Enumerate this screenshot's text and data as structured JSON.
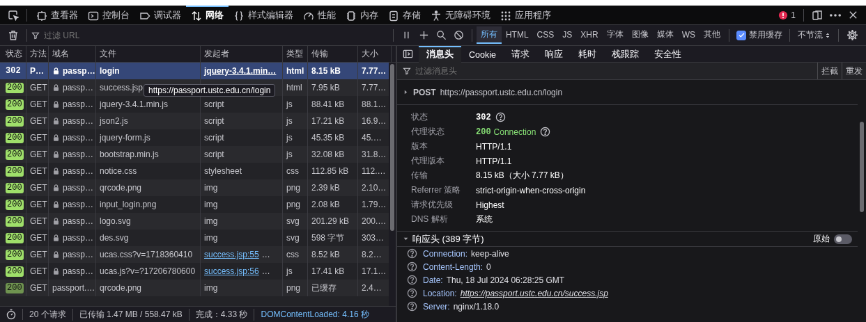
{
  "toolbar": {
    "tabs": [
      {
        "label": "查看器",
        "kind": "inspector",
        "selected": false
      },
      {
        "label": "控制台",
        "kind": "console",
        "selected": false
      },
      {
        "label": "调试器",
        "kind": "debugger",
        "selected": false
      },
      {
        "label": "网络",
        "kind": "network",
        "selected": true
      },
      {
        "label": "样式编辑器",
        "kind": "style",
        "selected": false
      },
      {
        "label": "性能",
        "kind": "performance",
        "selected": false
      },
      {
        "label": "内存",
        "kind": "memory",
        "selected": false
      },
      {
        "label": "存储",
        "kind": "storage",
        "selected": false
      },
      {
        "label": "无障碍环境",
        "kind": "accessibility",
        "selected": false
      },
      {
        "label": "应用程序",
        "kind": "application",
        "selected": false
      }
    ],
    "error_count": "1"
  },
  "network_toolbar": {
    "filter_placeholder": "过滤 URL",
    "type_filters": [
      {
        "label": "所有",
        "selected": true
      },
      {
        "label": "HTML",
        "selected": false
      },
      {
        "label": "CSS",
        "selected": false
      },
      {
        "label": "JS",
        "selected": false
      },
      {
        "label": "XHR",
        "selected": false
      },
      {
        "label": "字体",
        "selected": false
      },
      {
        "label": "图像",
        "selected": false
      },
      {
        "label": "媒体",
        "selected": false
      },
      {
        "label": "WS",
        "selected": false
      },
      {
        "label": "其他",
        "selected": false
      }
    ],
    "disable_cache": {
      "label": "禁用缓存",
      "checked": true
    },
    "throttle": "不节流"
  },
  "table": {
    "columns": [
      "状态",
      "方法",
      "域名",
      "文件",
      "发起者",
      "类型",
      "传输",
      "大小"
    ],
    "rows": [
      {
        "status": "302",
        "method": "P…",
        "secure": true,
        "domain": "passp…",
        "file": "login",
        "initiator": "jquery-3.4.1.min…",
        "initiator_link": true,
        "type": "html",
        "transfer": "8.15 kB",
        "size": "7.77…",
        "selected": true
      },
      {
        "status": "200",
        "method": "GET",
        "secure": true,
        "domain": "passp…",
        "file": "success.jsp",
        "type": "html",
        "transfer": "7.95 kB",
        "size": "7.77…",
        "selected": false
      },
      {
        "status": "200",
        "method": "GET",
        "secure": true,
        "domain": "passp…",
        "file": "jquery-3.4.1.min.js",
        "initiator": "script",
        "type": "js",
        "transfer": "88.41 kB",
        "size": "88.1…",
        "selected": false
      },
      {
        "status": "200",
        "method": "GET",
        "secure": true,
        "domain": "passp…",
        "file": "json2.js",
        "initiator": "script",
        "type": "js",
        "transfer": "17.21 kB",
        "size": "16.9…",
        "selected": false
      },
      {
        "status": "200",
        "method": "GET",
        "secure": true,
        "domain": "passp…",
        "file": "jquery-form.js",
        "initiator": "script",
        "type": "js",
        "transfer": "45.35 kB",
        "size": "45.…",
        "selected": false
      },
      {
        "status": "200",
        "method": "GET",
        "secure": true,
        "domain": "passp…",
        "file": "bootstrap.min.js",
        "initiator": "script",
        "type": "js",
        "transfer": "32.08 kB",
        "size": "31.8…",
        "selected": false
      },
      {
        "status": "200",
        "method": "GET",
        "secure": true,
        "domain": "passp…",
        "file": "notice.css",
        "initiator": "stylesheet",
        "type": "css",
        "transfer": "112.85 kB",
        "size": "112.…",
        "selected": false
      },
      {
        "status": "200",
        "method": "GET",
        "secure": true,
        "domain": "passp…",
        "file": "qrcode.png",
        "initiator": "img",
        "type": "png",
        "transfer": "2.39 kB",
        "size": "2.10…",
        "selected": false
      },
      {
        "status": "200",
        "method": "GET",
        "secure": true,
        "domain": "passp…",
        "file": "input_login.png",
        "initiator": "img",
        "type": "png",
        "transfer": "2.08 kB",
        "size": "1.79…",
        "selected": false
      },
      {
        "status": "200",
        "method": "GET",
        "secure": true,
        "domain": "passp…",
        "file": "logo.svg",
        "initiator": "img",
        "type": "svg",
        "transfer": "201.29 kB",
        "size": "200.…",
        "selected": false
      },
      {
        "status": "200",
        "method": "GET",
        "secure": true,
        "domain": "passp…",
        "file": "des.svg",
        "initiator": "img",
        "type": "svg",
        "transfer": "598 字节",
        "size": "303…",
        "selected": false
      },
      {
        "status": "200",
        "method": "GET",
        "secure": true,
        "domain": "passp…",
        "file": "ucas.css?v=1718360410",
        "initiator": "success.jsp:55",
        "initiator_link": true,
        "initiator_more": "…",
        "type": "css",
        "transfer": "8.52 kB",
        "size": "8.2…",
        "selected": false
      },
      {
        "status": "200",
        "method": "GET",
        "secure": true,
        "domain": "passp…",
        "file": "ucas.js?v=?17206780600",
        "initiator": "success.jsp:56",
        "initiator_link": true,
        "initiator_more": "…",
        "type": "js",
        "transfer": "17.41 kB",
        "size": "17.1…",
        "selected": false
      },
      {
        "status": "200",
        "method": "GET",
        "secure": false,
        "domain": "passport.…",
        "file": "qrcode.png",
        "initiator": "img",
        "type": "png",
        "transfer": "已缓存",
        "size": "2.4…",
        "cached": true,
        "selected": false
      }
    ],
    "tooltip": "https://passport.ustc.edu.cn/login"
  },
  "summary": [
    {
      "text": "20 个请求",
      "kind": "plain"
    },
    {
      "text": "已传输 1.47 MB / 558.47 kB",
      "kind": "plain"
    },
    {
      "text": "完成：4.33 秒",
      "kind": "plain"
    },
    {
      "text": "DOMContentLoaded: 4.16 秒",
      "kind": "event"
    }
  ],
  "details": {
    "tabs": [
      {
        "label": "消息头",
        "selected": true
      },
      {
        "label": "Cookie",
        "selected": false
      },
      {
        "label": "请求",
        "selected": false
      },
      {
        "label": "响应",
        "selected": false
      },
      {
        "label": "耗时",
        "selected": false
      },
      {
        "label": "栈跟踪",
        "selected": false
      },
      {
        "label": "安全性",
        "selected": false
      }
    ],
    "filter_placeholder": "过滤消息头",
    "actions": [
      "拦截",
      "重发"
    ],
    "request": {
      "method": "POST",
      "url": "https://passport.ustc.edu.cn/login"
    },
    "fields": [
      {
        "label": "状态",
        "value": "302",
        "kind": "code",
        "help": true
      },
      {
        "label": "代理状态",
        "value": "200",
        "note": "Connection",
        "kind": "proxy",
        "help": true
      },
      {
        "label": "版本",
        "value": "HTTP/1.1",
        "kind": "text",
        "help": false
      },
      {
        "label": "代理版本",
        "value": "HTTP/1.1",
        "kind": "text",
        "help": false
      },
      {
        "label": "传输",
        "value": "8.15 kB（大小 7.77 kB）",
        "kind": "text",
        "help": false
      },
      {
        "label": "Referrer 策略",
        "value": "strict-origin-when-cross-origin",
        "kind": "text",
        "help": false
      },
      {
        "label": "请求优先级",
        "value": "Highest",
        "kind": "text",
        "help": false
      },
      {
        "label": "DNS 解析",
        "value": "系统",
        "kind": "text",
        "help": false
      }
    ],
    "response_section": {
      "title": "响应头 (389 字节)",
      "expanded": true,
      "raw_label": "原始",
      "raw_on": false
    },
    "headers": [
      {
        "name": "Connection:",
        "value": "keep-alive",
        "link": false
      },
      {
        "name": "Content-Length:",
        "value": "0",
        "link": false
      },
      {
        "name": "Date:",
        "value": "Thu, 18 Jul 2024 06:28:25 GMT",
        "link": false
      },
      {
        "name": "Location:",
        "value": "https://passport.ustc.edu.cn/success.jsp",
        "link": true
      },
      {
        "name": "Server:",
        "value": "nginx/1.18.0",
        "link": false
      }
    ]
  }
}
